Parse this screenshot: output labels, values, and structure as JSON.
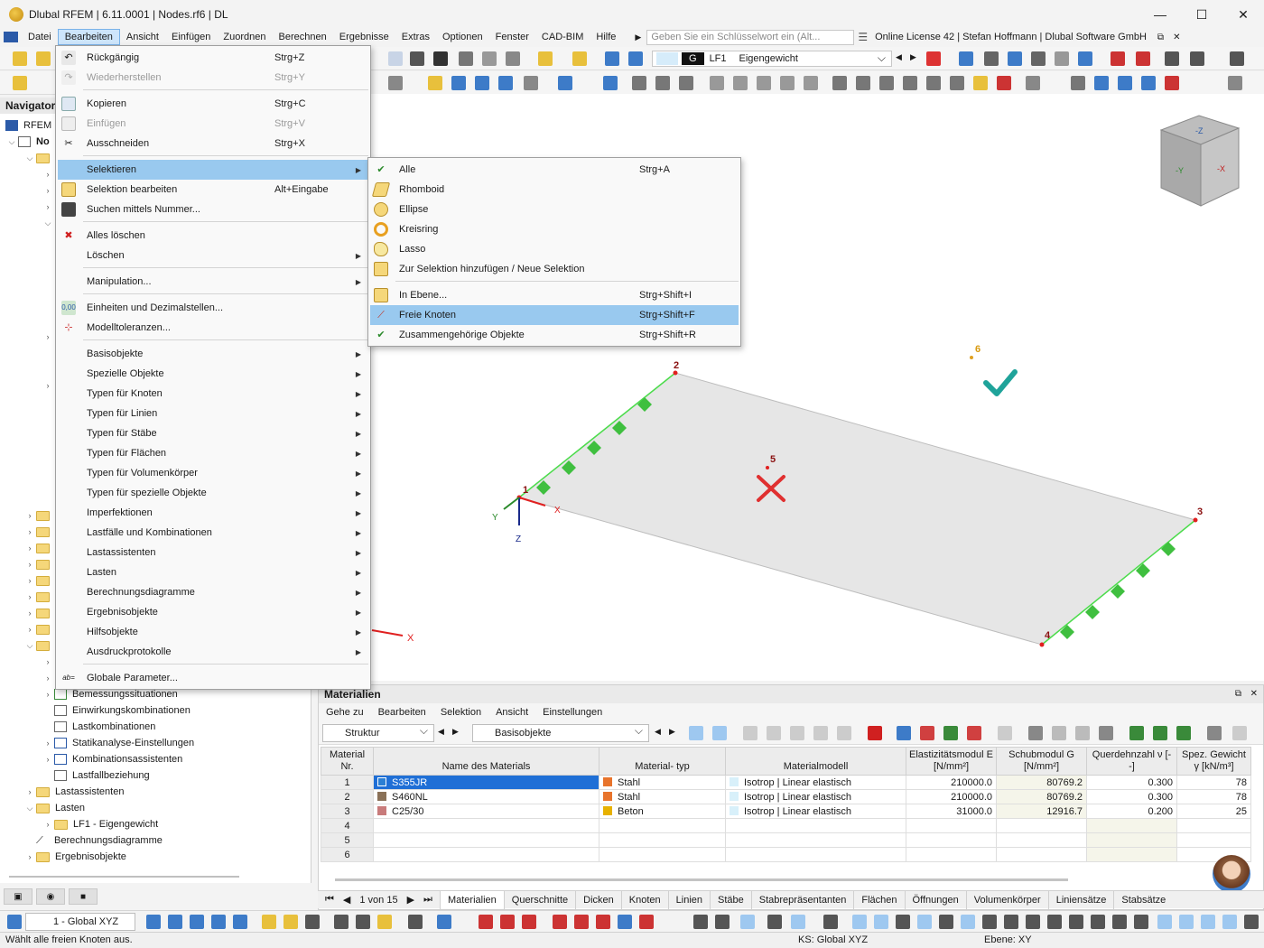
{
  "window": {
    "title": "Dlubal RFEM | 6.11.0001 | Nodes.rf6 | DL",
    "controls": {
      "minimize": "—",
      "maximize": "☐",
      "close": "✕"
    }
  },
  "menubar": {
    "items": [
      "Datei",
      "Bearbeiten",
      "Ansicht",
      "Einfügen",
      "Zuordnen",
      "Berechnen",
      "Ergebnisse",
      "Extras",
      "Optionen",
      "Fenster",
      "CAD-BIM",
      "Hilfe"
    ],
    "active": "Bearbeiten",
    "search_placeholder": "Geben Sie ein Schlüsselwort ein (Alt...",
    "license": "Online License 42 | Stefan Hoffmann | Dlubal Software GmbH"
  },
  "loadcase": {
    "badge": "G",
    "code": "LF1",
    "name": "Eigengewicht"
  },
  "navigator": {
    "title": "Navigator",
    "root": "RFEM",
    "model": "No",
    "items": [
      {
        "label": "Bemessungssituationen",
        "level": 3
      },
      {
        "label": "Einwirkungskombinationen",
        "level": 3
      },
      {
        "label": "Lastkombinationen",
        "level": 3
      },
      {
        "label": "Statikanalyse-Einstellungen",
        "level": 3
      },
      {
        "label": "Kombinationsassistenten",
        "level": 3
      },
      {
        "label": "Lastfallbeziehung",
        "level": 3
      },
      {
        "label": "Lastassistenten",
        "level": 1
      },
      {
        "label": "Lasten",
        "level": 1
      },
      {
        "label": "LF1 - Eigengewicht",
        "level": 2
      },
      {
        "label": "Berechnungsdiagramme",
        "level": 1
      },
      {
        "label": "Ergebnisobjekte",
        "level": 1
      }
    ]
  },
  "edit_menu": {
    "items": [
      {
        "label": "Rückgängig",
        "shortcut": "Strg+Z",
        "icon": "undo-icon",
        "disabled": false
      },
      {
        "label": "Wiederherstellen",
        "shortcut": "Strg+Y",
        "icon": "redo-icon",
        "disabled": true
      },
      {
        "label": "Kopieren",
        "shortcut": "Strg+C",
        "icon": "copy-icon",
        "disabled": false
      },
      {
        "label": "Einfügen",
        "shortcut": "Strg+V",
        "icon": "paste-icon",
        "disabled": true
      },
      {
        "label": "Ausschneiden",
        "shortcut": "Strg+X",
        "icon": "cut-icon",
        "disabled": false
      },
      {
        "label": "Selektieren",
        "shortcut": "",
        "icon": "",
        "submenu": true,
        "highlight": true
      },
      {
        "label": "Selektion bearbeiten",
        "shortcut": "Alt+Eingabe",
        "icon": "edit-selection-icon"
      },
      {
        "label": "Suchen mittels Nummer...",
        "shortcut": "",
        "icon": "binoculars-icon"
      },
      {
        "label": "Alles löschen",
        "shortcut": "",
        "icon": "delete-all-icon"
      },
      {
        "label": "Löschen",
        "shortcut": "",
        "icon": "",
        "submenu": true
      },
      {
        "label": "Manipulation...",
        "shortcut": "",
        "icon": "",
        "submenu": true
      },
      {
        "label": "Einheiten und Dezimalstellen...",
        "shortcut": "",
        "icon": "units-icon"
      },
      {
        "label": "Modelltoleranzen...",
        "shortcut": "",
        "icon": "tolerance-icon"
      },
      {
        "label": "Basisobjekte",
        "submenu": true
      },
      {
        "label": "Spezielle Objekte",
        "submenu": true
      },
      {
        "label": "Typen für Knoten",
        "submenu": true
      },
      {
        "label": "Typen für Linien",
        "submenu": true
      },
      {
        "label": "Typen für Stäbe",
        "submenu": true
      },
      {
        "label": "Typen für Flächen",
        "submenu": true
      },
      {
        "label": "Typen für Volumenkörper",
        "submenu": true
      },
      {
        "label": "Typen für spezielle Objekte",
        "submenu": true
      },
      {
        "label": "Imperfektionen",
        "submenu": true
      },
      {
        "label": "Lastfälle und Kombinationen",
        "submenu": true
      },
      {
        "label": "Lastassistenten",
        "submenu": true
      },
      {
        "label": "Lasten",
        "submenu": true
      },
      {
        "label": "Berechnungsdiagramme",
        "submenu": true
      },
      {
        "label": "Ergebnisobjekte",
        "submenu": true
      },
      {
        "label": "Hilfsobjekte",
        "submenu": true
      },
      {
        "label": "Ausdruckprotokolle",
        "submenu": true
      },
      {
        "label": "Globale Parameter...",
        "icon": "global-parameters-icon"
      }
    ]
  },
  "select_submenu": {
    "items": [
      {
        "label": "Alle",
        "shortcut": "Strg+A"
      },
      {
        "label": "Rhomboid",
        "shortcut": ""
      },
      {
        "label": "Ellipse",
        "shortcut": ""
      },
      {
        "label": "Kreisring",
        "shortcut": ""
      },
      {
        "label": "Lasso",
        "shortcut": ""
      },
      {
        "label": "Zur Selektion hinzufügen / Neue Selektion",
        "shortcut": ""
      },
      {
        "label": "In Ebene...",
        "shortcut": "Strg+Shift+I"
      },
      {
        "label": "Freie Knoten",
        "shortcut": "Strg+Shift+F"
      },
      {
        "label": "Zusammengehörige Objekte",
        "shortcut": "Strg+Shift+R"
      }
    ]
  },
  "viewport": {
    "node_labels": [
      "1",
      "2",
      "3",
      "4",
      "5",
      "6"
    ],
    "axis_labels": {
      "x": "X",
      "y": "Y",
      "z": "Z"
    },
    "cube_labels": {
      "z": "-Z",
      "y": "-Y",
      "x": "-X"
    }
  },
  "materials": {
    "title": "Materialien",
    "menu": [
      "Gehe zu",
      "Bearbeiten",
      "Selektion",
      "Ansicht",
      "Einstellungen"
    ],
    "combo_structure": "Struktur",
    "combo_objects": "Basisobjekte",
    "headers": {
      "nr": "Material Nr.",
      "name": "Name des Materials",
      "type": "Material- typ",
      "model": "Materialmodell",
      "e": "Elastizitätsmodul E [N/mm²]",
      "g": "Schubmodul G [N/mm²]",
      "nu": "Querdehnzahl ν [--]",
      "gamma": "Spez. Gewicht γ [kN/m³]"
    },
    "rows": [
      {
        "nr": "1",
        "name": "S355JR",
        "color": "#2b7fd4",
        "type": "Stahl",
        "type_color": "#e8742c",
        "model": "Isotrop | Linear elastisch",
        "e": "210000.0",
        "g": "80769.2",
        "nu": "0.300",
        "gamma": "78"
      },
      {
        "nr": "2",
        "name": "S460NL",
        "color": "#8a7158",
        "type": "Stahl",
        "type_color": "#e8742c",
        "model": "Isotrop | Linear elastisch",
        "e": "210000.0",
        "g": "80769.2",
        "nu": "0.300",
        "gamma": "78"
      },
      {
        "nr": "3",
        "name": "C25/30",
        "color": "#c87b7b",
        "type": "Beton",
        "type_color": "#e7b100",
        "model": "Isotrop | Linear elastisch",
        "e": "31000.0",
        "g": "12916.7",
        "nu": "0.200",
        "gamma": "25"
      },
      {
        "nr": "4"
      },
      {
        "nr": "5"
      },
      {
        "nr": "6"
      }
    ],
    "pager": "1 von 15",
    "tabs": [
      "Materialien",
      "Querschnitte",
      "Dicken",
      "Knoten",
      "Linien",
      "Stäbe",
      "Stabrepräsentanten",
      "Flächen",
      "Öffnungen",
      "Volumenkörper",
      "Liniensätze",
      "Stabsätze"
    ]
  },
  "bottombar": {
    "coord_system": "1 - Global XYZ"
  },
  "status": {
    "message": "Wählt alle freien Knoten aus.",
    "ks": "KS: Global XYZ",
    "ebene": "Ebene: XY"
  },
  "colors": {
    "menu_highlight": "#99c9ef",
    "selection": "#1f6fd6",
    "support_green": "#3fbf3f",
    "check_teal": "#1fa39a",
    "cross_red": "#e03030"
  }
}
